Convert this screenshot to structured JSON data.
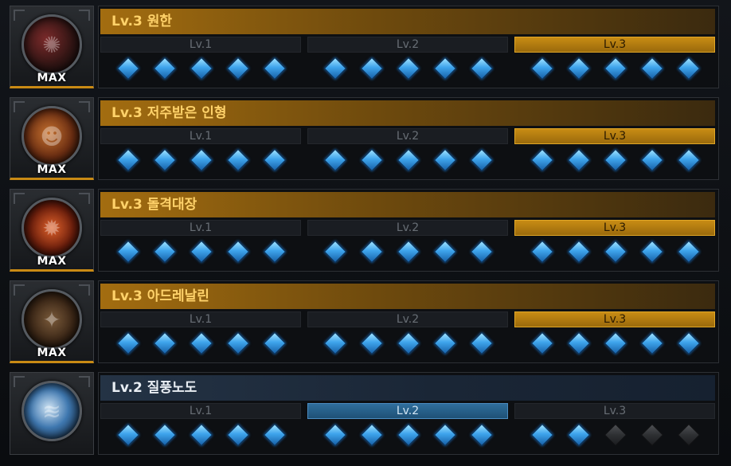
{
  "skills": [
    {
      "icon": "howling-beast-icon",
      "title": "Lv.3 원한",
      "badge": "MAX",
      "theme": "gold",
      "level_labels": [
        "Lv.1",
        "Lv.2",
        "Lv.3"
      ],
      "active_level": 3,
      "filled_gems": [
        5,
        5,
        5
      ]
    },
    {
      "icon": "cursed-doll-face-icon",
      "title": "Lv.3 저주받은 인형",
      "badge": "MAX",
      "theme": "gold",
      "level_labels": [
        "Lv.1",
        "Lv.2",
        "Lv.3"
      ],
      "active_level": 3,
      "filled_gems": [
        5,
        5,
        5
      ]
    },
    {
      "icon": "fire-charge-icon",
      "title": "Lv.3 돌격대장",
      "badge": "MAX",
      "theme": "gold",
      "level_labels": [
        "Lv.1",
        "Lv.2",
        "Lv.3"
      ],
      "active_level": 3,
      "filled_gems": [
        5,
        5,
        5
      ]
    },
    {
      "icon": "adrenaline-figure-icon",
      "title": "Lv.3 아드레날린",
      "badge": "MAX",
      "theme": "gold",
      "level_labels": [
        "Lv.1",
        "Lv.2",
        "Lv.3"
      ],
      "active_level": 3,
      "filled_gems": [
        5,
        5,
        5
      ]
    },
    {
      "icon": "wind-swirl-icon",
      "title": "Lv.2 질풍노도",
      "badge": "",
      "theme": "blue",
      "level_labels": [
        "Lv.1",
        "Lv.2",
        "Lv.3"
      ],
      "active_level": 2,
      "filled_gems": [
        5,
        5,
        2
      ]
    }
  ],
  "gem_count_per_level": 5,
  "colors": {
    "gold_accent": "#c98a14",
    "blue_accent": "#2f6e9c",
    "gem_active": "#3ea4ec",
    "gem_inactive": "#3a3c40"
  }
}
